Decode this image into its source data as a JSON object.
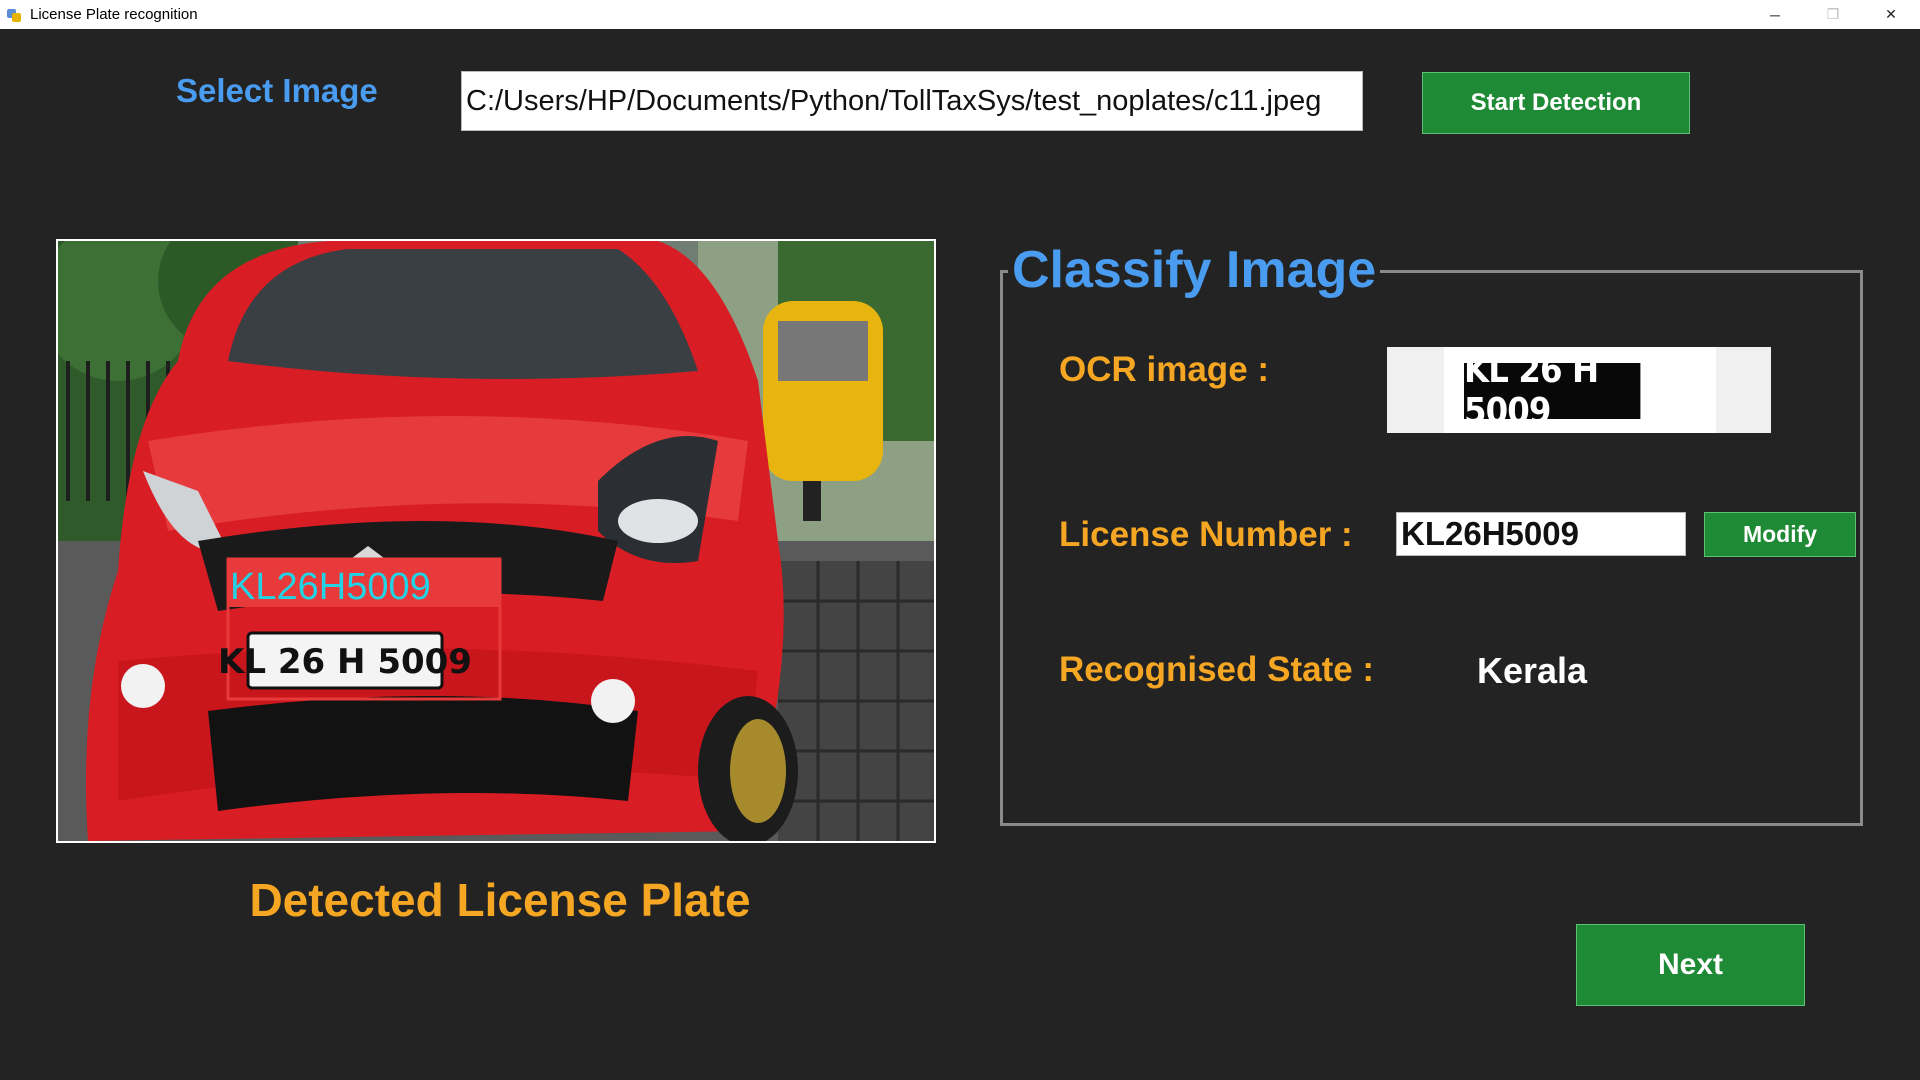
{
  "window": {
    "title": "License Plate recognition",
    "controls": {
      "minimize": "─",
      "restore": "❐",
      "close": "✕"
    }
  },
  "select": {
    "label": "Select Image",
    "path_value": "C:/Users/HP/Documents/Python/TollTaxSys/test_noplates/c11.jpeg",
    "start_button": "Start Detection"
  },
  "detection": {
    "overlay_text": "KL26H5009",
    "plate_text": "KL 26 H 5009",
    "caption": "Detected License Plate"
  },
  "classify": {
    "title": "Classify Image",
    "ocr_label": "OCR image :",
    "ocr_plate_text": "KL 26 H 5009",
    "license_label": "License Number :",
    "license_value": "KL26H5009",
    "modify_button": "Modify",
    "state_label": "Recognised State :",
    "state_value": "Kerala"
  },
  "next_button": "Next",
  "colors": {
    "background": "#232323",
    "label_blue": "#4a9cf0",
    "label_orange": "#f5a623",
    "button_green": "#1f8a35",
    "overlay_text": "#22d3e6",
    "overlay_box": "#e83a3a"
  }
}
